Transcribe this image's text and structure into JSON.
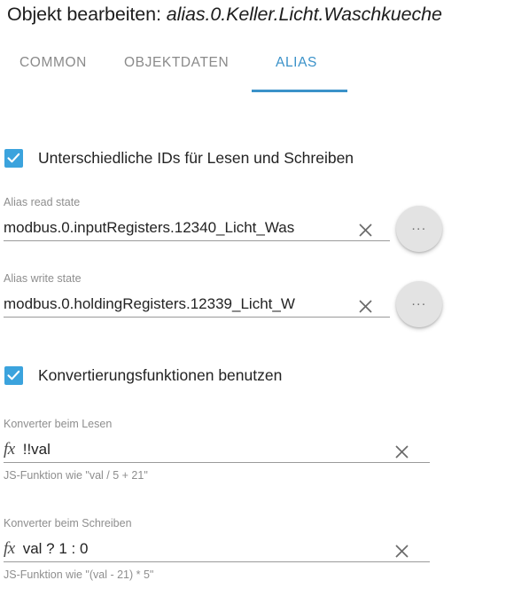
{
  "header": {
    "title_prefix": "Objekt bearbeiten: ",
    "object_path": "alias.0.Keller.Licht.Waschkueche"
  },
  "tabs": [
    {
      "label": "COMMON",
      "active": false
    },
    {
      "label": "OBJEKTDATEN",
      "active": false
    },
    {
      "label": "ALIAS",
      "active": true
    }
  ],
  "colors": {
    "accent": "#3b92c9",
    "checkbox": "#3ba3dd",
    "label_gray": "#8e8e8e",
    "tab_inactive": "#8a8a8a",
    "round_button": "#e3e3e3"
  },
  "checkboxes": {
    "different_ids": {
      "label": "Unterschiedliche IDs für Lesen und Schreiben",
      "checked": true
    },
    "use_conversion": {
      "label": "Konvertierungsfunktionen benutzen",
      "checked": true
    }
  },
  "fields": {
    "alias_read": {
      "label": "Alias read state",
      "value": "modbus.0.inputRegisters.12340_Licht_Was",
      "placeholder": "",
      "clear_icon": "close-icon",
      "select_button": "..."
    },
    "alias_write": {
      "label": "Alias write state",
      "value": "modbus.0.holdingRegisters.12339_Licht_W",
      "placeholder": "",
      "clear_icon": "close-icon",
      "select_button": "..."
    },
    "converter_read": {
      "label": "Konverter beim Lesen",
      "prefix_icon": "fx",
      "value": "!!val",
      "placeholder": "",
      "helper": "JS-Funktion wie \"val / 5 + 21\"",
      "clear_icon": "close-icon"
    },
    "converter_write": {
      "label": "Konverter beim Schreiben",
      "prefix_icon": "fx",
      "value": "val ? 1 : 0",
      "placeholder": "",
      "helper": "JS-Funktion wie \"(val - 21) * 5\"",
      "clear_icon": "close-icon"
    }
  }
}
